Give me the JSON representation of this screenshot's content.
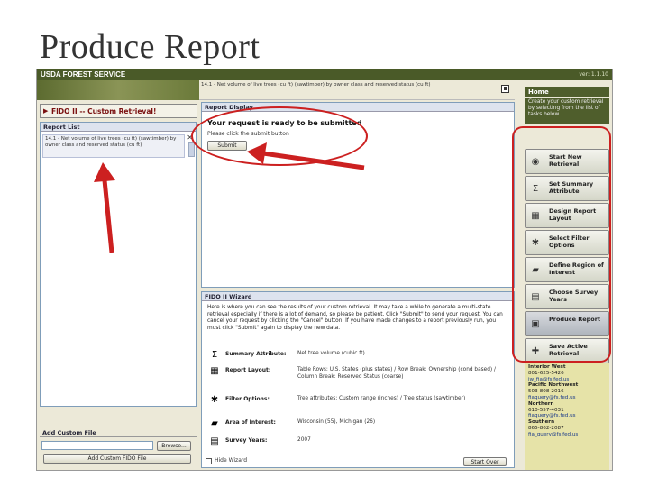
{
  "slide": {
    "title": "Produce Report"
  },
  "app": {
    "brand": "USDA FOREST SERVICE",
    "version": "ver: 1.1.10",
    "path_text": "14.1 - Net volume of live trees (cu ft) (sawtimber) by owner class and reserved status (cu ft)"
  },
  "left": {
    "retrieval_title": "FIDO II -- Custom Retrieval!",
    "report_list_header": "Report List",
    "report_item": "14.1 - Net volume of live trees (cu ft) (sawtimber) by owner class and reserved status (cu ft)",
    "custom_file_header": "Add Custom File",
    "browse_label": "Browse...",
    "add_button_label": "Add Custom FIDO File"
  },
  "report_display": {
    "header": "Report Display",
    "ready_text": "Your request is ready to be submitted",
    "click_text": "Please click the submit button",
    "submit_label": "Submit"
  },
  "wizard": {
    "header": "FIDO II Wizard",
    "text": "Here is where you can see the results of your custom retrieval. It may take a while to generate a multi-state retrieval especially if there is a lot of demand, so please be patient. Click \"Submit\" to send your request. You can cancel your request by clicking the \"Cancel\" button. If you have made changes to a report previously run, you must click \"Submit\" again to display the new data.",
    "rows": [
      {
        "icon": "sigma-icon",
        "glyph": "Σ",
        "label": "Summary Attribute:",
        "value": "Net tree volume (cubic ft)"
      },
      {
        "icon": "layout-icon",
        "glyph": "▦",
        "label": "Report Layout:",
        "value": "Table Rows: U.S. States (plus states) / Row Break: Ownership (cond based) / Column Break: Reserved Status (coarse)"
      },
      {
        "icon": "filter-icon",
        "glyph": "✱",
        "label": "Filter Options:",
        "value": "Tree attributes: Custom range (inches) / Tree status (sawtimber)"
      },
      {
        "icon": "map-icon",
        "glyph": "▰",
        "label": "Area of Interest:",
        "value": "Wisconsin (55), Michigan (26)"
      },
      {
        "icon": "calendar-icon",
        "glyph": "▤",
        "label": "Survey Years:",
        "value": "2007"
      }
    ],
    "hide_label": "Hide Wizard",
    "start_over_label": "Start Over"
  },
  "right": {
    "home_label": "Home",
    "intro": "Create your custom retrieval by selecting from the list of tasks below.",
    "nav": [
      {
        "icon": "new-retrieval-icon",
        "glyph": "◉",
        "label": "Start New Retrieval"
      },
      {
        "icon": "sigma-icon",
        "glyph": "Σ",
        "label": "Set Summary Attribute"
      },
      {
        "icon": "layout-icon",
        "glyph": "▦",
        "label": "Design Report Layout"
      },
      {
        "icon": "filter-icon",
        "glyph": "✱",
        "label": "Select Filter Options"
      },
      {
        "icon": "map-icon",
        "glyph": "▰",
        "label": "Define Region of Interest"
      },
      {
        "icon": "calendar-icon",
        "glyph": "▤",
        "label": "Choose Survey Years"
      },
      {
        "icon": "report-icon",
        "glyph": "▣",
        "label": "Produce Report"
      },
      {
        "icon": "save-icon",
        "glyph": "✚",
        "label": "Save Active Retrieval"
      }
    ],
    "contacts": [
      {
        "region": "Interior West",
        "phone": "801-625-5426",
        "email": "iw_fia@fs.fed.us"
      },
      {
        "region": "Pacific Northwest",
        "phone": "503-808-2016",
        "email": "fiaquery@fs.fed.us"
      },
      {
        "region": "Northern",
        "phone": "610-557-4031",
        "email": "fiaquery@fs.fed.us"
      },
      {
        "region": "Southern",
        "phone": "865-862-2087",
        "email": "fia_query@fs.fed.us"
      }
    ]
  },
  "colors": {
    "annotation": "#cc2020",
    "brand_green": "#4f5e2c",
    "title_red": "#7a1010"
  }
}
